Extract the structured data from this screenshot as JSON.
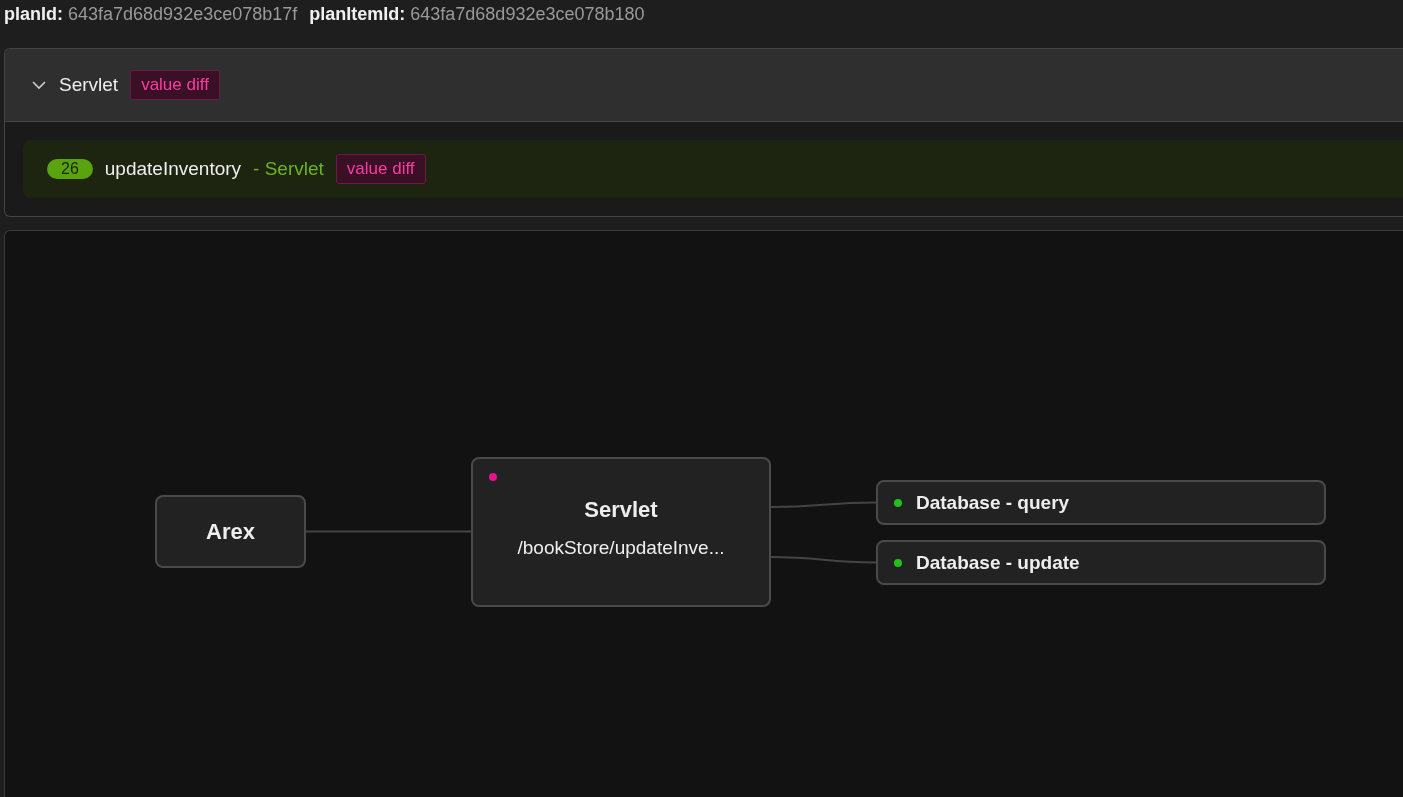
{
  "header": [
    {
      "label": "planId:",
      "value": "643fa7d68d932e3ce078b17f"
    },
    {
      "label": "planItemId:",
      "value": "643fa7d68d932e3ce078b180"
    }
  ],
  "panel": {
    "title": "Servlet",
    "expanded": true,
    "tag": "value diff",
    "items": [
      {
        "count": "26",
        "name": "updateInventory",
        "category": "- Servlet",
        "tag": "value diff"
      }
    ]
  },
  "diagram": {
    "nodes": [
      {
        "kind": "root",
        "title": "Arex"
      },
      {
        "kind": "main",
        "title": "Servlet",
        "subtitle": "/bookStore/updateInve...",
        "color": "#e0158f"
      },
      {
        "kind": "leaf",
        "title": "Database - query",
        "color": "#22c01a"
      },
      {
        "kind": "leaf",
        "title": "Database - update",
        "color": "#22c01a"
      }
    ]
  }
}
